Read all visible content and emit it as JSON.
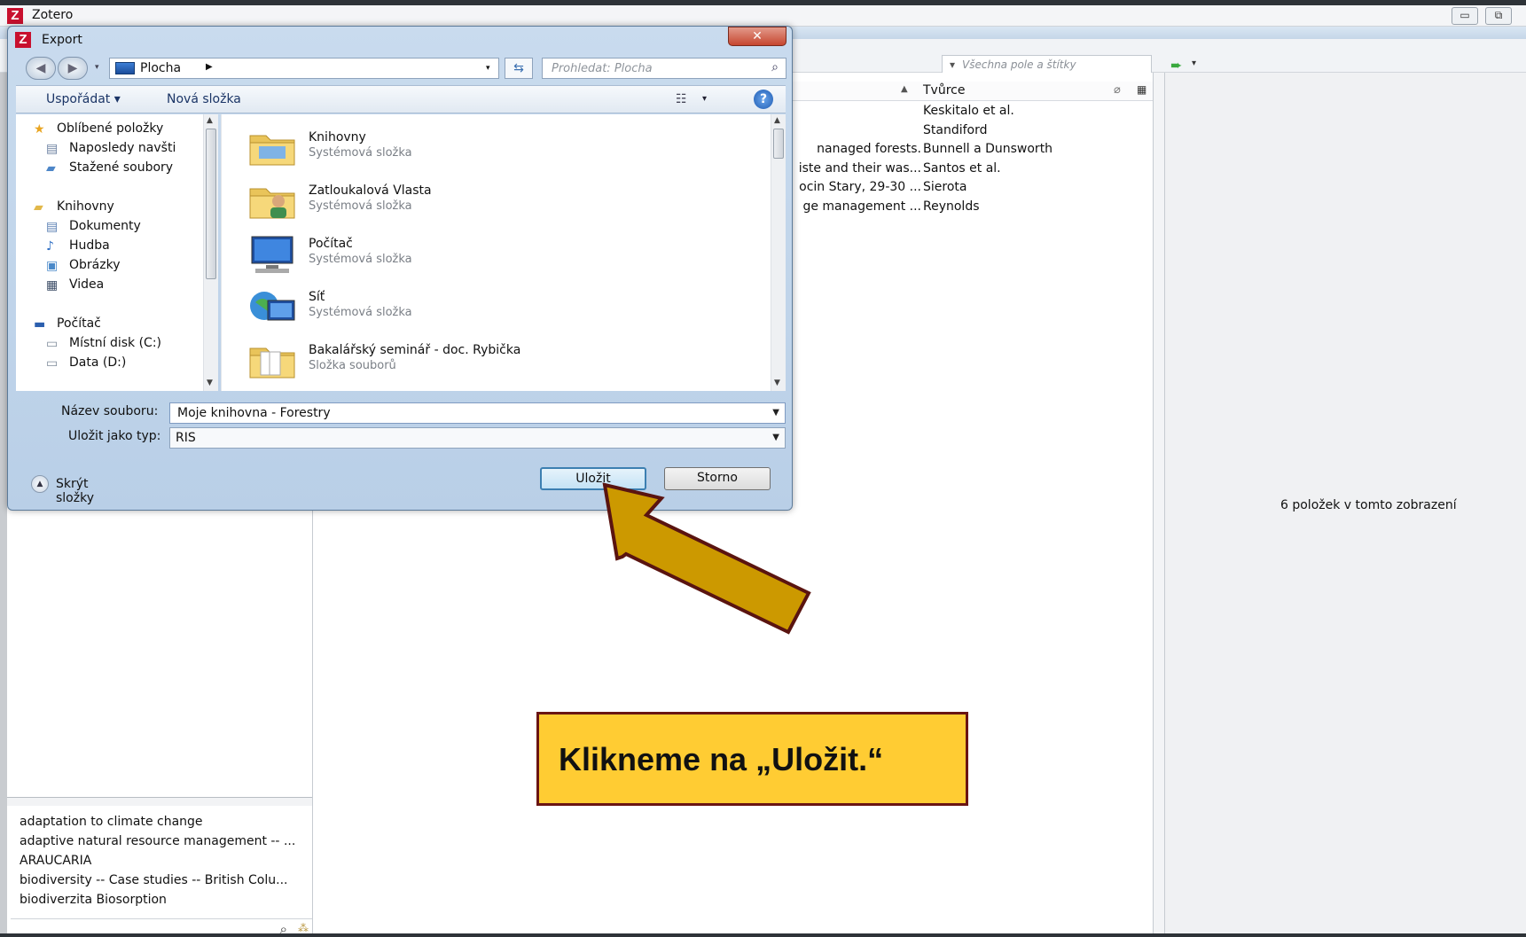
{
  "zotero": {
    "title": "Zotero",
    "search_placeholder": "Všechna pole a štítky",
    "column_creator": "Tvůrce",
    "items": [
      {
        "title": "",
        "creator": "Keskitalo et al."
      },
      {
        "title": "",
        "creator": "Standiford"
      },
      {
        "title": "nanaged forests.",
        "creator": "Bunnell a Dunsworth"
      },
      {
        "title": "iste and their was...",
        "creator": "Santos et al."
      },
      {
        "title": "ocin Stary, 29-30 ...",
        "creator": "Sierota"
      },
      {
        "title": "ge management ...",
        "creator": "Reynolds"
      }
    ],
    "item_count": "6 položek v tomto zobrazení",
    "tags": [
      "adaptation to climate change",
      "adaptive natural resource management -- ...",
      "ARAUCARIA",
      "biodiversity -- Case studies -- British Colu...",
      "biodiverzita    Biosorption"
    ]
  },
  "dialog": {
    "title": "Export",
    "close_label": "✕",
    "location": "Plocha",
    "search_placeholder": "Prohledat: Plocha",
    "organize": "Uspořádat ▾",
    "new_folder": "Nová složka",
    "help": "?",
    "nav": [
      {
        "label": "Oblíbené položky",
        "level": "group",
        "icon": "star-icon",
        "glyph": "★",
        "color": "#e9a521"
      },
      {
        "label": "Naposledy navšti",
        "level": "child",
        "icon": "recent-places-icon",
        "glyph": "▤",
        "color": "#6a7fa0"
      },
      {
        "label": "Stažené soubory",
        "level": "child",
        "icon": "downloads-folder-icon",
        "glyph": "▰",
        "color": "#4d86c8"
      },
      {
        "label": "",
        "level": "gap"
      },
      {
        "label": "Knihovny",
        "level": "group",
        "icon": "libraries-icon",
        "glyph": "▰",
        "color": "#e2b84a"
      },
      {
        "label": "Dokumenty",
        "level": "child",
        "icon": "documents-icon",
        "glyph": "▤",
        "color": "#5a7fb3"
      },
      {
        "label": "Hudba",
        "level": "child",
        "icon": "music-icon",
        "glyph": "♪",
        "color": "#2f6fc4"
      },
      {
        "label": "Obrázky",
        "level": "child",
        "icon": "pictures-icon",
        "glyph": "▣",
        "color": "#4a89c9"
      },
      {
        "label": "Videa",
        "level": "child",
        "icon": "videos-icon",
        "glyph": "▦",
        "color": "#3c4c66"
      },
      {
        "label": "",
        "level": "gap"
      },
      {
        "label": "Počítač",
        "level": "group",
        "icon": "computer-icon",
        "glyph": "▬",
        "color": "#2b5fae"
      },
      {
        "label": "Místní disk (C:)",
        "level": "child",
        "icon": "local-disk-icon",
        "glyph": "▭",
        "color": "#7d8a99"
      },
      {
        "label": "Data (D:)",
        "level": "child",
        "icon": "data-disk-icon",
        "glyph": "▭",
        "color": "#7d8a99"
      }
    ],
    "files": [
      {
        "name": "Knihovny",
        "type": "Systémová složka",
        "icon": "libraries-folder-icon"
      },
      {
        "name": "Zatloukalová Vlasta",
        "type": "Systémová složka",
        "icon": "user-folder-icon"
      },
      {
        "name": "Počítač",
        "type": "Systémová složka",
        "icon": "computer-icon"
      },
      {
        "name": "Síť",
        "type": "Systémová složka",
        "icon": "network-icon"
      },
      {
        "name": "Bakalářský seminář - doc. Rybička",
        "type": "Složka souborů",
        "icon": "folder-icon"
      }
    ],
    "filename_label": "Název souboru:",
    "filename_value": "Moje knihovna - Forestry",
    "filetype_label": "Uložit jako typ:",
    "filetype_value": "RIS",
    "hide_folders": "Skrýt složky",
    "save_button": "Uložit",
    "cancel_button": "Storno"
  },
  "annotation": {
    "text": "Klikneme na „Uložit.“",
    "box_color": "#ffcc33",
    "border_color": "#6a1513",
    "arrow_color": "#cc9900"
  }
}
